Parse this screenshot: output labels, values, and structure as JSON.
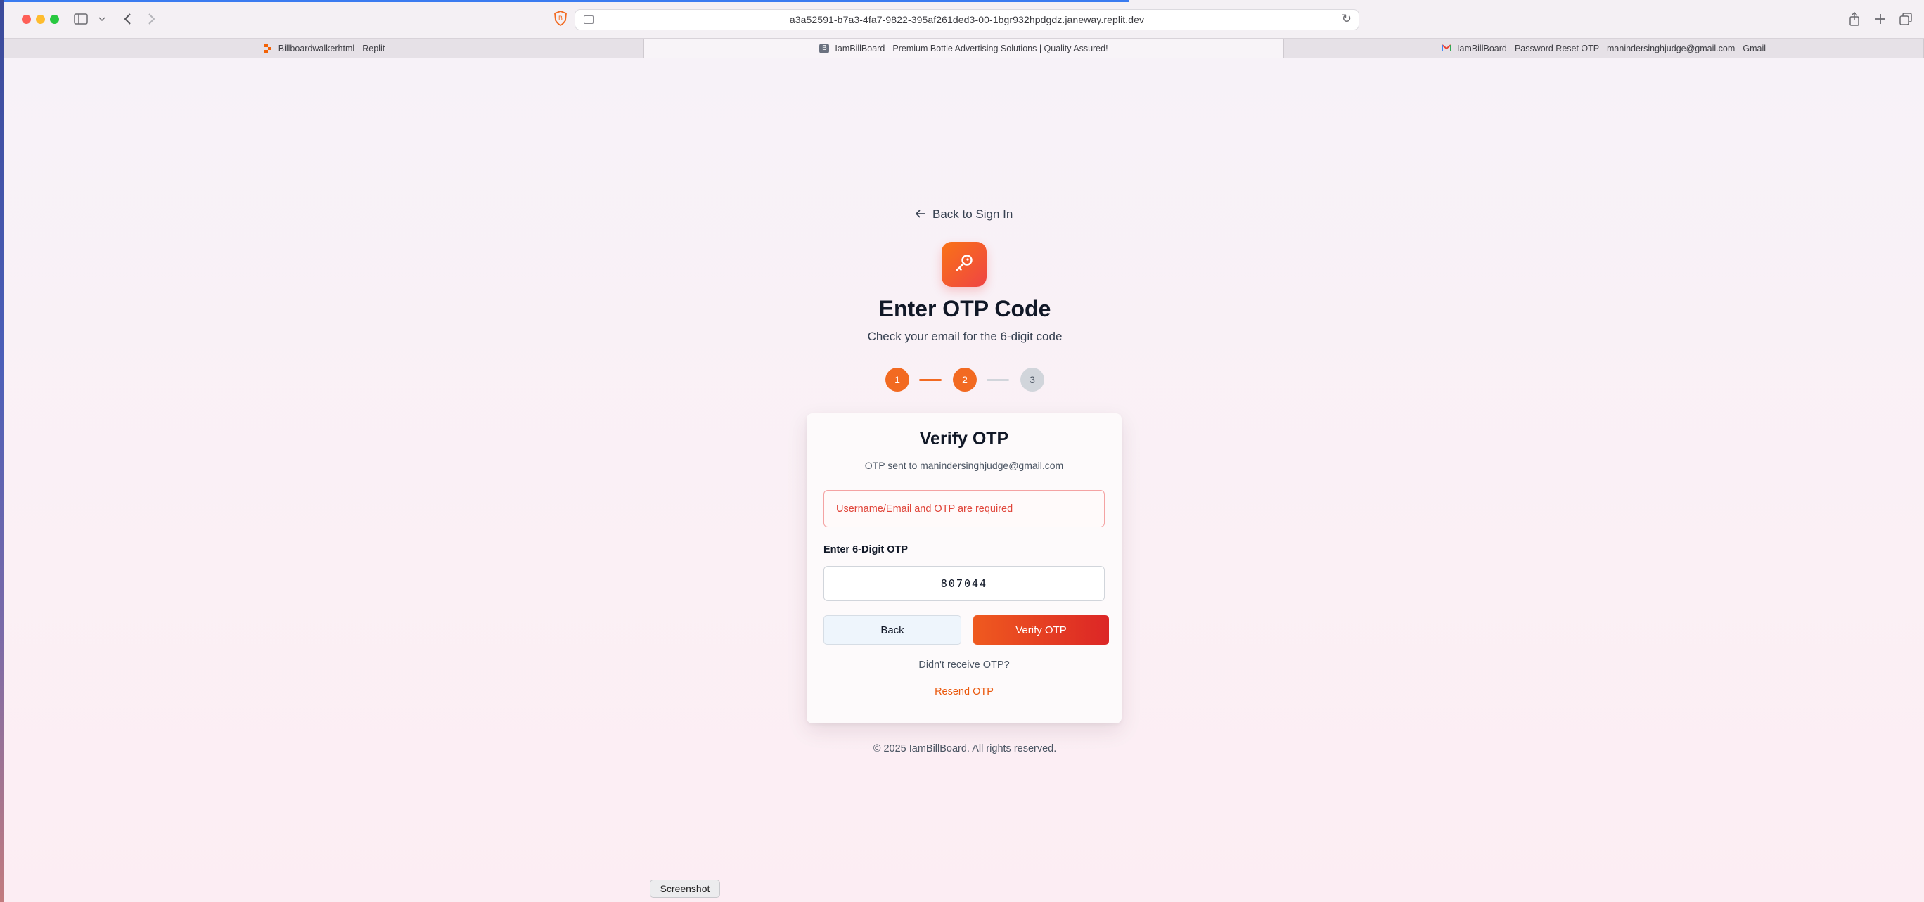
{
  "browser": {
    "url": "a3a52591-b7a3-4fa7-9822-395af261ded3-00-1bgr932hpdgdz.janeway.replit.dev",
    "tabs": [
      {
        "title": "Billboardwalkerhtml - Replit",
        "favicon": "replit-icon",
        "active": false
      },
      {
        "title": "IamBillBoard - Premium Bottle Advertising Solutions | Quality Assured!",
        "favicon": "site-icon",
        "active": true
      },
      {
        "title": "IamBillBoard - Password Reset OTP - manindersinghjudge@gmail.com - Gmail",
        "favicon": "gmail-icon",
        "active": false
      }
    ]
  },
  "page": {
    "back_link": "Back to Sign In",
    "title": "Enter OTP Code",
    "subtitle": "Check your email for the 6-digit code",
    "steps": [
      {
        "label": "1",
        "state": "done"
      },
      {
        "label": "2",
        "state": "done"
      },
      {
        "label": "3",
        "state": "todo"
      }
    ],
    "card": {
      "title": "Verify OTP",
      "subtitle": "OTP sent to manindersinghjudge@gmail.com",
      "error": "Username/Email and OTP are required",
      "otp_label": "Enter 6-Digit OTP",
      "otp_value": "807044",
      "back_button": "Back",
      "verify_button": "Verify OTP",
      "didnt_receive": "Didn't receive OTP?",
      "resend": "Resend OTP"
    },
    "footer": "© 2025 IamBillBoard. All rights reserved."
  },
  "overlay": {
    "screenshot_label": "Screenshot"
  },
  "colors": {
    "accent": "#f26a21",
    "error": "#e0453a",
    "step_pending": "#d1d5db"
  }
}
